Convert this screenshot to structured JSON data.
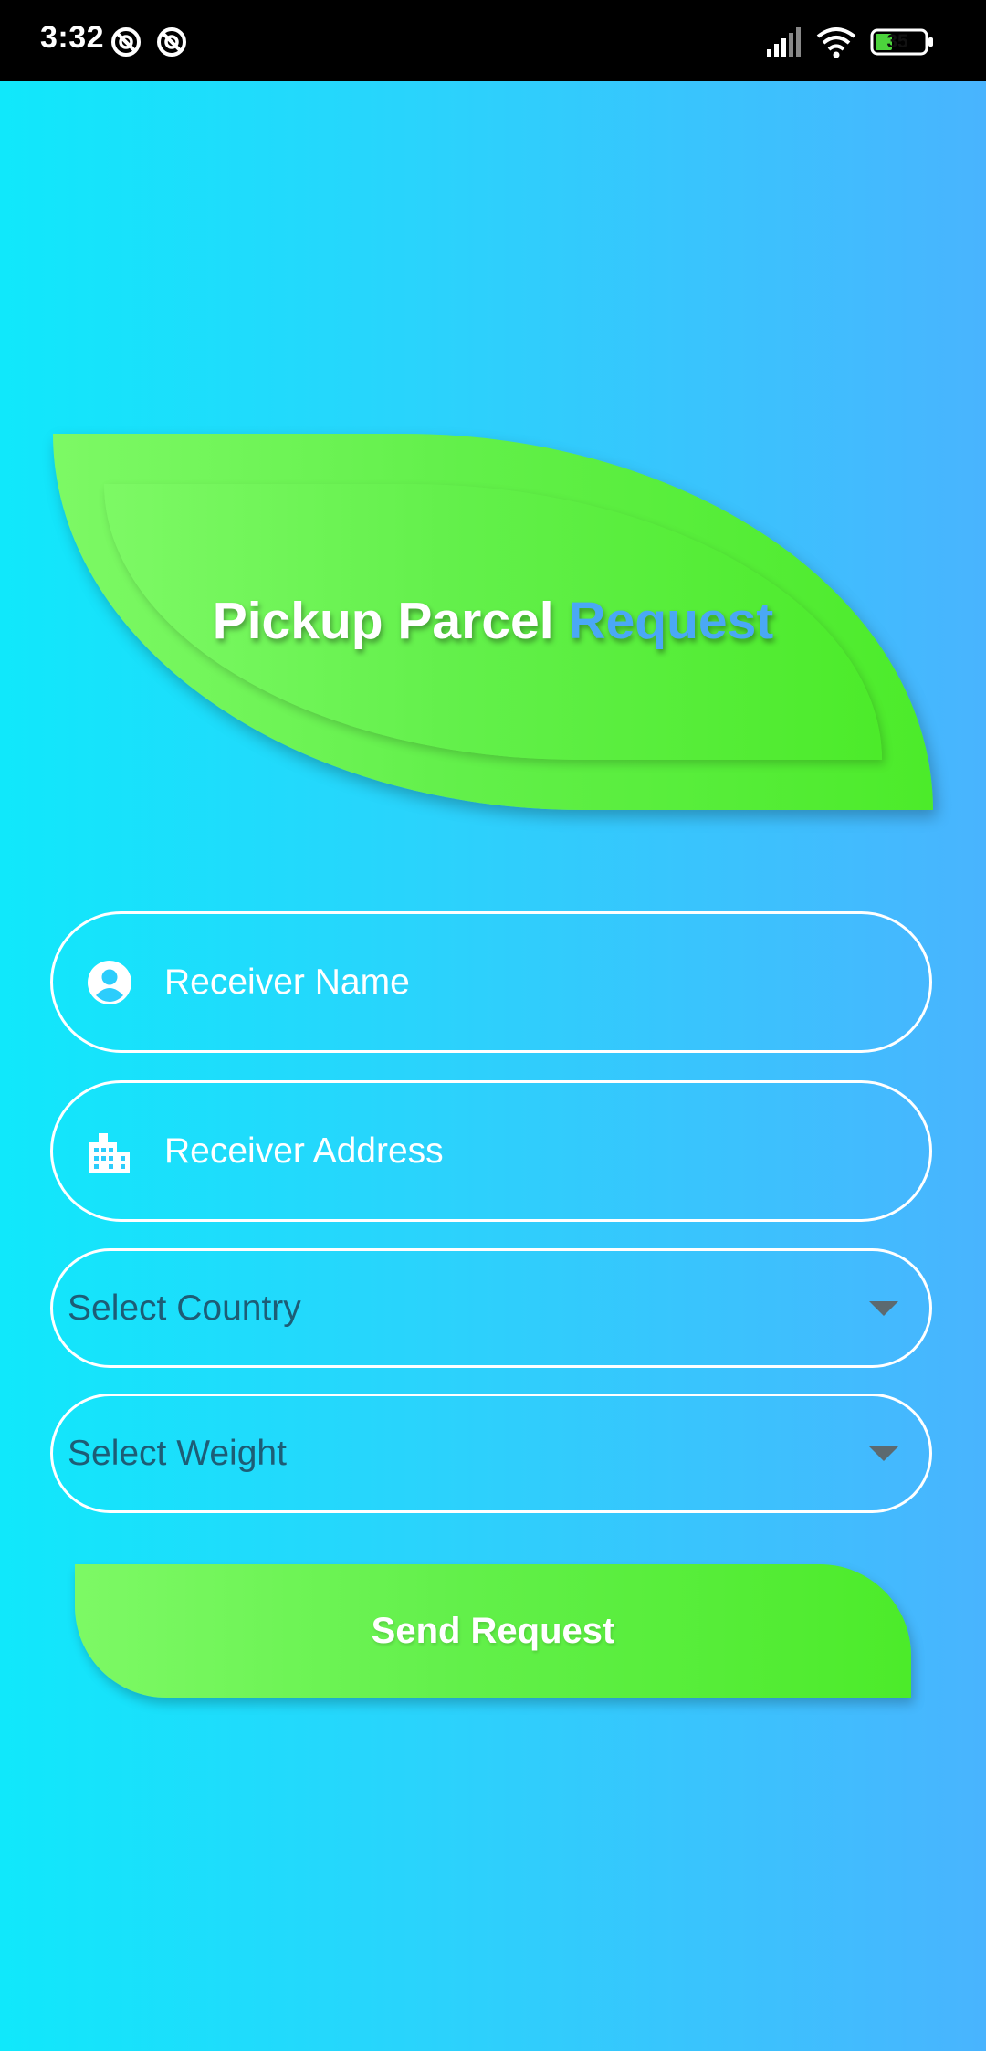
{
  "status_bar": {
    "time": "3:32",
    "battery": "35",
    "icons": [
      "do-not-disturb-icon",
      "do-not-disturb-icon",
      "signal-icon",
      "wifi-icon",
      "battery-icon"
    ]
  },
  "header": {
    "title_part1": "Pickup Parcel",
    "title_part2": "Request"
  },
  "form": {
    "receiver_name_placeholder": "Receiver Name",
    "receiver_address_placeholder": "Receiver Address",
    "country_select": "Select Country",
    "weight_select": "Select Weight",
    "submit_label": "Send Request"
  },
  "colors": {
    "background_start": "#10e8fb",
    "background_end": "#49b4fe",
    "green_start": "#7df965",
    "green_end": "#4ceb2a",
    "title_accent": "#4aa8f5",
    "select_text": "#1d5d76"
  }
}
